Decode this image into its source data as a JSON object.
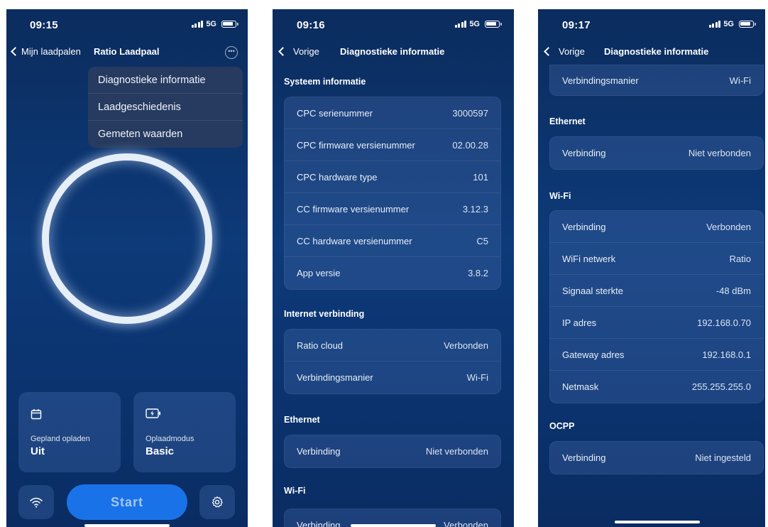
{
  "screen1": {
    "status": {
      "time": "09:15",
      "network": "5G"
    },
    "nav": {
      "back_label": "Mijn laadpalen",
      "title": "Ratio Laadpaal",
      "more_icon": "ellipsis-circle-icon"
    },
    "menu": [
      "Diagnostieke informatie",
      "Laadgeschiedenis",
      "Gemeten waarden"
    ],
    "tiles": [
      {
        "icon": "calendar-icon",
        "label": "Gepland opladen",
        "value": "Uit"
      },
      {
        "icon": "battery-charge-icon",
        "label": "Oplaadmodus",
        "value": "Basic"
      }
    ],
    "start_label": "Start",
    "wifi_icon": "wifi-icon",
    "settings_icon": "gear-icon"
  },
  "screen2": {
    "status": {
      "time": "09:16",
      "network": "5G"
    },
    "nav": {
      "back_label": "Vorige",
      "title": "Diagnostieke informatie"
    },
    "sections": [
      {
        "title": "Systeem informatie",
        "rows": [
          {
            "label": "CPC serienummer",
            "value": "3000597"
          },
          {
            "label": "CPC firmware versienummer",
            "value": "02.00.28"
          },
          {
            "label": "CPC hardware type",
            "value": "101"
          },
          {
            "label": "CC firmware versienummer",
            "value": "3.12.3"
          },
          {
            "label": "CC hardware versienummer",
            "value": "C5"
          },
          {
            "label": "App versie",
            "value": "3.8.2"
          }
        ]
      },
      {
        "title": "Internet verbinding",
        "rows": [
          {
            "label": "Ratio cloud",
            "value": "Verbonden"
          },
          {
            "label": "Verbindingsmanier",
            "value": "Wi-Fi"
          }
        ]
      },
      {
        "title": "Ethernet",
        "rows": [
          {
            "label": "Verbinding",
            "value": "Niet verbonden"
          }
        ]
      },
      {
        "title": "Wi-Fi",
        "rows": [
          {
            "label": "Verbinding",
            "value": "Verbonden"
          }
        ]
      }
    ]
  },
  "screen3": {
    "status": {
      "time": "09:17",
      "network": "5G"
    },
    "nav": {
      "back_label": "Vorige",
      "title": "Diagnostieke informatie"
    },
    "partial_row": {
      "label": "Verbindingsmanier",
      "value": "Wi-Fi"
    },
    "sections": [
      {
        "title": "Ethernet",
        "rows": [
          {
            "label": "Verbinding",
            "value": "Niet verbonden"
          }
        ]
      },
      {
        "title": "Wi-Fi",
        "rows": [
          {
            "label": "Verbinding",
            "value": "Verbonden"
          },
          {
            "label": "WiFi netwerk",
            "value": "Ratio"
          },
          {
            "label": "Signaal sterkte",
            "value": "-48 dBm"
          },
          {
            "label": "IP adres",
            "value": "192.168.0.70"
          },
          {
            "label": "Gateway adres",
            "value": "192.168.0.1"
          },
          {
            "label": "Netmask",
            "value": "255.255.255.0"
          }
        ]
      },
      {
        "title": "OCPP",
        "rows": [
          {
            "label": "Verbinding",
            "value": "Niet ingesteld"
          }
        ]
      }
    ]
  }
}
